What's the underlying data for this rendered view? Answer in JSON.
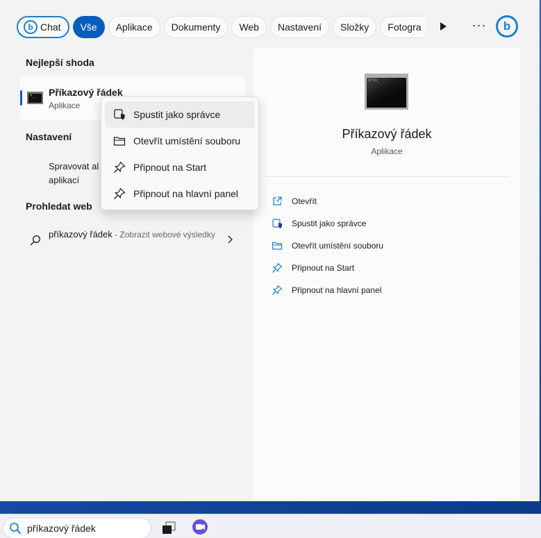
{
  "filters": {
    "chat_label": "Chat",
    "chat_icon": "bing-b",
    "items": [
      "Vše",
      "Aplikace",
      "Dokumenty",
      "Web",
      "Nastavení",
      "Složky",
      "Fotogra"
    ],
    "active": "Vše",
    "more": "···"
  },
  "left": {
    "best_match_heading": "Nejlepší shoda",
    "best_match": {
      "title": "Příkazový řádek",
      "subtitle": "Aplikace",
      "icon": "command-prompt-icon"
    },
    "settings_heading": "Nastavení",
    "settings_item": "Spravovat al aplikací",
    "web_heading": "Prohledat web",
    "web_item": {
      "query": "příkazový řádek",
      "suffix": " - Zobrazit webové výsledky"
    }
  },
  "context_menu": {
    "items": [
      "Spustit jako správce",
      "Otevřít umístění souboru",
      "Připnout na Start",
      "Připnout na hlavní panel"
    ],
    "highlighted": "Spustit jako správce"
  },
  "preview": {
    "title": "Příkazový řádek",
    "subtitle": "Aplikace",
    "actions": [
      "Otevřít",
      "Spustit jako správce",
      "Otevřít umístění souboru",
      "Připnout na Start",
      "Připnout na hlavní panel"
    ]
  },
  "taskbar": {
    "search_value": "příkazový řádek"
  },
  "colors": {
    "accent": "#0a5dbd",
    "bing": "#1f7fc9",
    "panel": "#f3f3f3"
  }
}
